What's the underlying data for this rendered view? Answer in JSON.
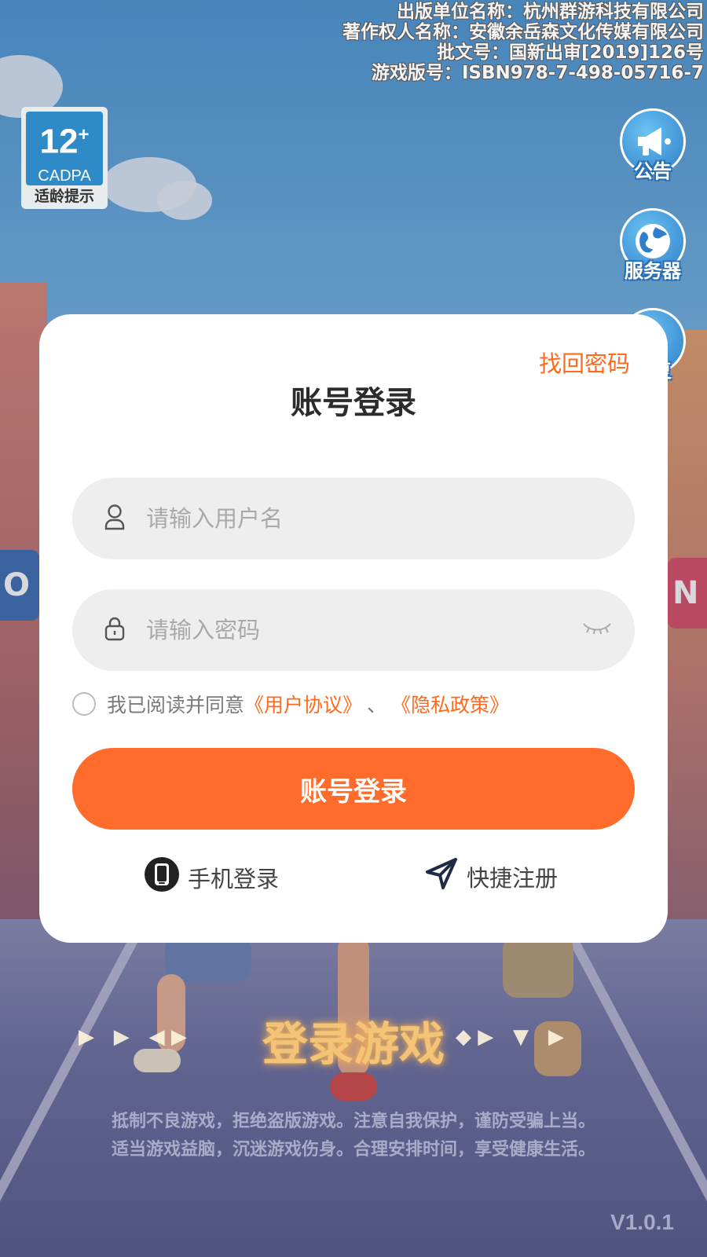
{
  "publication": {
    "publisher": "出版单位名称：杭州群游科技有限公司",
    "copyright_holder": "著作权人名称：安徽余岳森文化传媒有限公司",
    "approval_no": "批文号：国新出审[2019]126号",
    "isbn": "游戏版号：ISBN978-7-498-05716-7"
  },
  "age_badge": {
    "age": "12",
    "plus": "+",
    "org": "CADPA",
    "tip": "适龄提示"
  },
  "side_buttons": [
    {
      "label": "公告",
      "icon": "megaphone-icon"
    },
    {
      "label": "服务器",
      "icon": "globe-icon"
    },
    {
      "label": "修复",
      "icon": "repair-icon"
    }
  ],
  "login_card": {
    "forgot_label": "找回密码",
    "title": "账号登录",
    "username_placeholder": "请输入用户名",
    "password_placeholder": "请输入密码",
    "agree_prefix": "我已阅读并同意",
    "user_agreement": "《用户协议》",
    "separator": "、",
    "privacy_policy": "《隐私政策》",
    "login_button": "账号登录",
    "phone_login": "手机登录",
    "quick_register": "快捷注册"
  },
  "bottom": {
    "game_title": "登录游戏",
    "notice_line1": "抵制不良游戏，拒绝盗版游戏。注意自我保护，谨防受骗上当。",
    "notice_line2": "适当游戏益脑，沉迷游戏伤身。合理安排时间，享受健康生活。",
    "version": "V1.0.1"
  },
  "colors": {
    "accent": "#ff6b2a",
    "link": "#ff6a1f",
    "field_bg": "#eeeeee"
  }
}
